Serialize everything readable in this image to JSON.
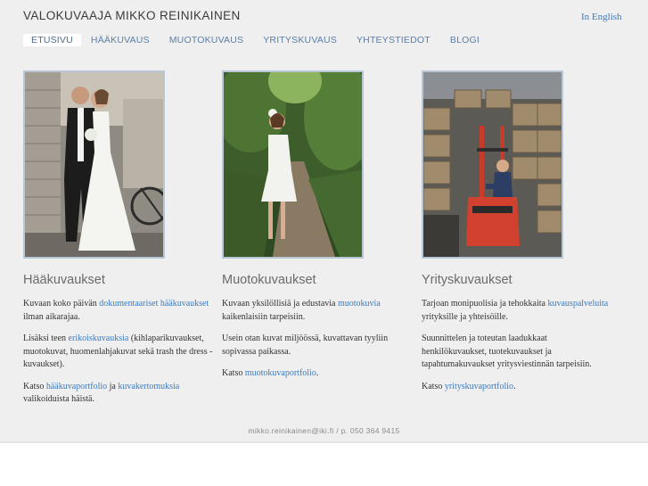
{
  "header": {
    "site_title": "VALOKUVAAJA MIKKO REINIKAINEN",
    "language_link": "In English"
  },
  "nav": {
    "items": [
      {
        "label": "ETUSIVU",
        "active": true
      },
      {
        "label": "HÄÄKUVAUS",
        "active": false
      },
      {
        "label": "MUOTOKUVAUS",
        "active": false
      },
      {
        "label": "YRITYSKUVAUS",
        "active": false
      },
      {
        "label": "YHTEYSTIEDOT",
        "active": false
      },
      {
        "label": "BLOGI",
        "active": false
      }
    ]
  },
  "columns": {
    "wedding": {
      "image_desc": "wedding couple kissing",
      "title": "Hääkuvaukset",
      "p1_before": "Kuvaan koko päivän ",
      "p1_link": "dokumentaariset hääkuvaukset",
      "p1_after": " ilman aikarajaa.",
      "p2_before": "Lisäksi teen ",
      "p2_link": "erikoiskuvauksia",
      "p2_after": " (kihlaparikuvaukset, muotokuvat, huomenlahjakuvat sekä trash the dress -kuvaukset).",
      "p3_before": "Katso ",
      "p3_link1": "hääkuvaportfolio",
      "p3_mid": " ja ",
      "p3_link2": "kuvakertomuksia",
      "p3_after": " valikoiduista häistä."
    },
    "portrait": {
      "image_desc": "pregnant woman on forest path",
      "title": "Muotokuvaukset",
      "p1_before": "Kuvaan yksilöllisiä ja edustavia ",
      "p1_link": "muotokuvia",
      "p1_after": " kaikenlaisiin tarpeisiin.",
      "p2": "Usein otan kuvat miljöössä, kuvattavan tyyliin sopivassa paikassa.",
      "p3_before": "Katso ",
      "p3_link": "muotokuvaportfolio",
      "p3_after": "."
    },
    "business": {
      "image_desc": "forklift driver in warehouse",
      "title": "Yrityskuvaukset",
      "p1_before": "Tarjoan monipuolisia ja tehokkaita ",
      "p1_link": "kuvauspalveluita",
      "p1_after": " yrityksille ja yhteisöille.",
      "p2": "Suunnittelen ja toteutan laadukkaat henkilökuvaukset, tuotekuvaukset ja tapahtumakuvaukset yritysviestinnän tarpeisiin.",
      "p3_before": "Katso ",
      "p3_link": "yrityskuvaportfolio",
      "p3_after": "."
    }
  },
  "footer": {
    "contact": "mikko.reinikainen@iki.fi / p. 050 364 9415"
  },
  "colors": {
    "background": "#efefef",
    "link": "#3b7bbf",
    "nav": "#5b7fa8",
    "photo_border": "#b8c7d6"
  }
}
